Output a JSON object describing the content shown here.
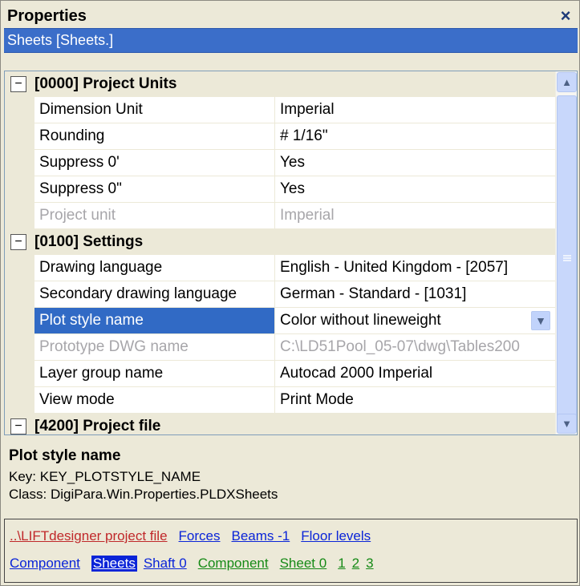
{
  "panel": {
    "title": "Properties",
    "close_glyph": "×"
  },
  "object_selector": {
    "value": "Sheets [Sheets.]"
  },
  "grid": {
    "categories": [
      {
        "label": "[0000] Project Units",
        "rows": [
          {
            "name": "Dimension Unit",
            "value": "Imperial"
          },
          {
            "name": "Rounding",
            "value": "# 1/16\""
          },
          {
            "name": "Suppress 0'",
            "value": "Yes"
          },
          {
            "name": "Suppress 0\"",
            "value": "Yes"
          },
          {
            "name": "Project unit",
            "value": "Imperial",
            "disabled": true
          }
        ]
      },
      {
        "label": "[0100] Settings",
        "rows": [
          {
            "name": "Drawing language",
            "value": "English - United Kingdom - [2057]"
          },
          {
            "name": "Secondary drawing language",
            "value": "German - Standard - [1031]"
          },
          {
            "name": "Plot style name",
            "value": "Color without lineweight",
            "selected": true
          },
          {
            "name": "Prototype DWG name",
            "value": "C:\\LD51Pool_05-07\\dwg\\Tables200",
            "disabled": true
          },
          {
            "name": "Layer group name",
            "value": "Autocad 2000 Imperial"
          },
          {
            "name": "View mode",
            "value": "Print Mode"
          }
        ]
      },
      {
        "label": "[4200] Project file",
        "rows": []
      }
    ]
  },
  "description": {
    "title": "Plot style name",
    "key_line": "Key: KEY_PLOTSTYLE_NAME",
    "class_line": "Class:  DigiPara.Win.Properties.PLDXSheets"
  },
  "links": {
    "row1": [
      {
        "label": "..\\LIFTdesigner project file",
        "color": "red"
      },
      {
        "label": "Forces",
        "color": "blue"
      },
      {
        "label": "Beams -1",
        "color": "blue"
      },
      {
        "label": "Floor levels",
        "color": "blue"
      }
    ],
    "row2": [
      {
        "label": "Component",
        "color": "blue"
      },
      {
        "label": "Sheets",
        "color": "blue",
        "active": true
      },
      {
        "label": "Shaft 0",
        "color": "blue"
      },
      {
        "label": "Component",
        "color": "green"
      },
      {
        "label": "Sheet 0",
        "color": "green"
      },
      {
        "label": "1",
        "color": "green"
      },
      {
        "label": "2",
        "color": "green"
      },
      {
        "label": "3",
        "color": "green"
      }
    ]
  },
  "icons": {
    "expander": "minus-box-icon",
    "dropdown": "chevron-down-icon",
    "scroll_up": "chevron-up-icon",
    "scroll_down": "chevron-down-icon",
    "close": "close-icon"
  },
  "colors": {
    "selection": "#316ac5",
    "object_bar": "#3b6ec9",
    "panel_bg": "#ece9d8",
    "link_red": "#c0282a",
    "link_blue": "#0a24d8",
    "link_green": "#168a16"
  }
}
